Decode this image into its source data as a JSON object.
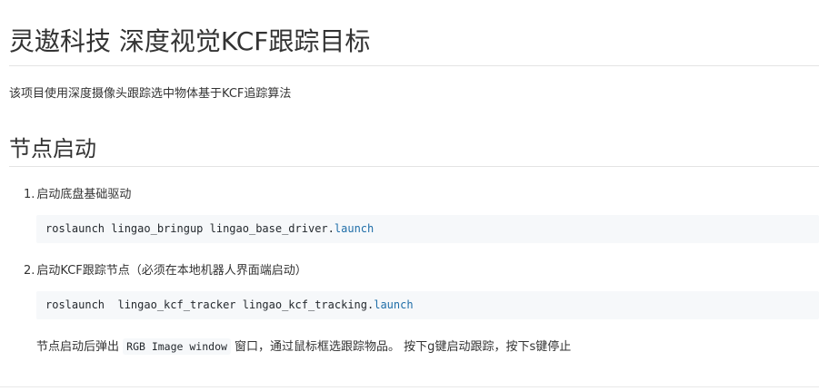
{
  "title": "灵遨科技 深度视觉KCF跟踪目标",
  "intro": "该项目使用深度摄像头跟踪选中物体基于KCF追踪算法",
  "section_heading": "节点启动",
  "steps": [
    {
      "number": "1.",
      "text": "启动底盘基础驱动",
      "code_prefix": "roslaunch lingao_bringup lingao_base_driver.",
      "code_keyword": "launch"
    },
    {
      "number": "2.",
      "text": "启动KCF跟踪节点（必须在本地机器人界面端启动）",
      "code_prefix": "roslaunch  lingao_kcf_tracker lingao_kcf_tracking.",
      "code_keyword": "launch"
    }
  ],
  "note": {
    "before": "节点启动后弹出 ",
    "inline_code": "RGB Image window",
    "after": " 窗口，通过鼠标框选跟踪物品。 按下g键启动跟踪，按下s键停止"
  },
  "colors": {
    "text": "#333333",
    "code_background": "#f6f8fa",
    "code_keyword": "#1f6ea8",
    "rule": "#e3e3e3"
  }
}
